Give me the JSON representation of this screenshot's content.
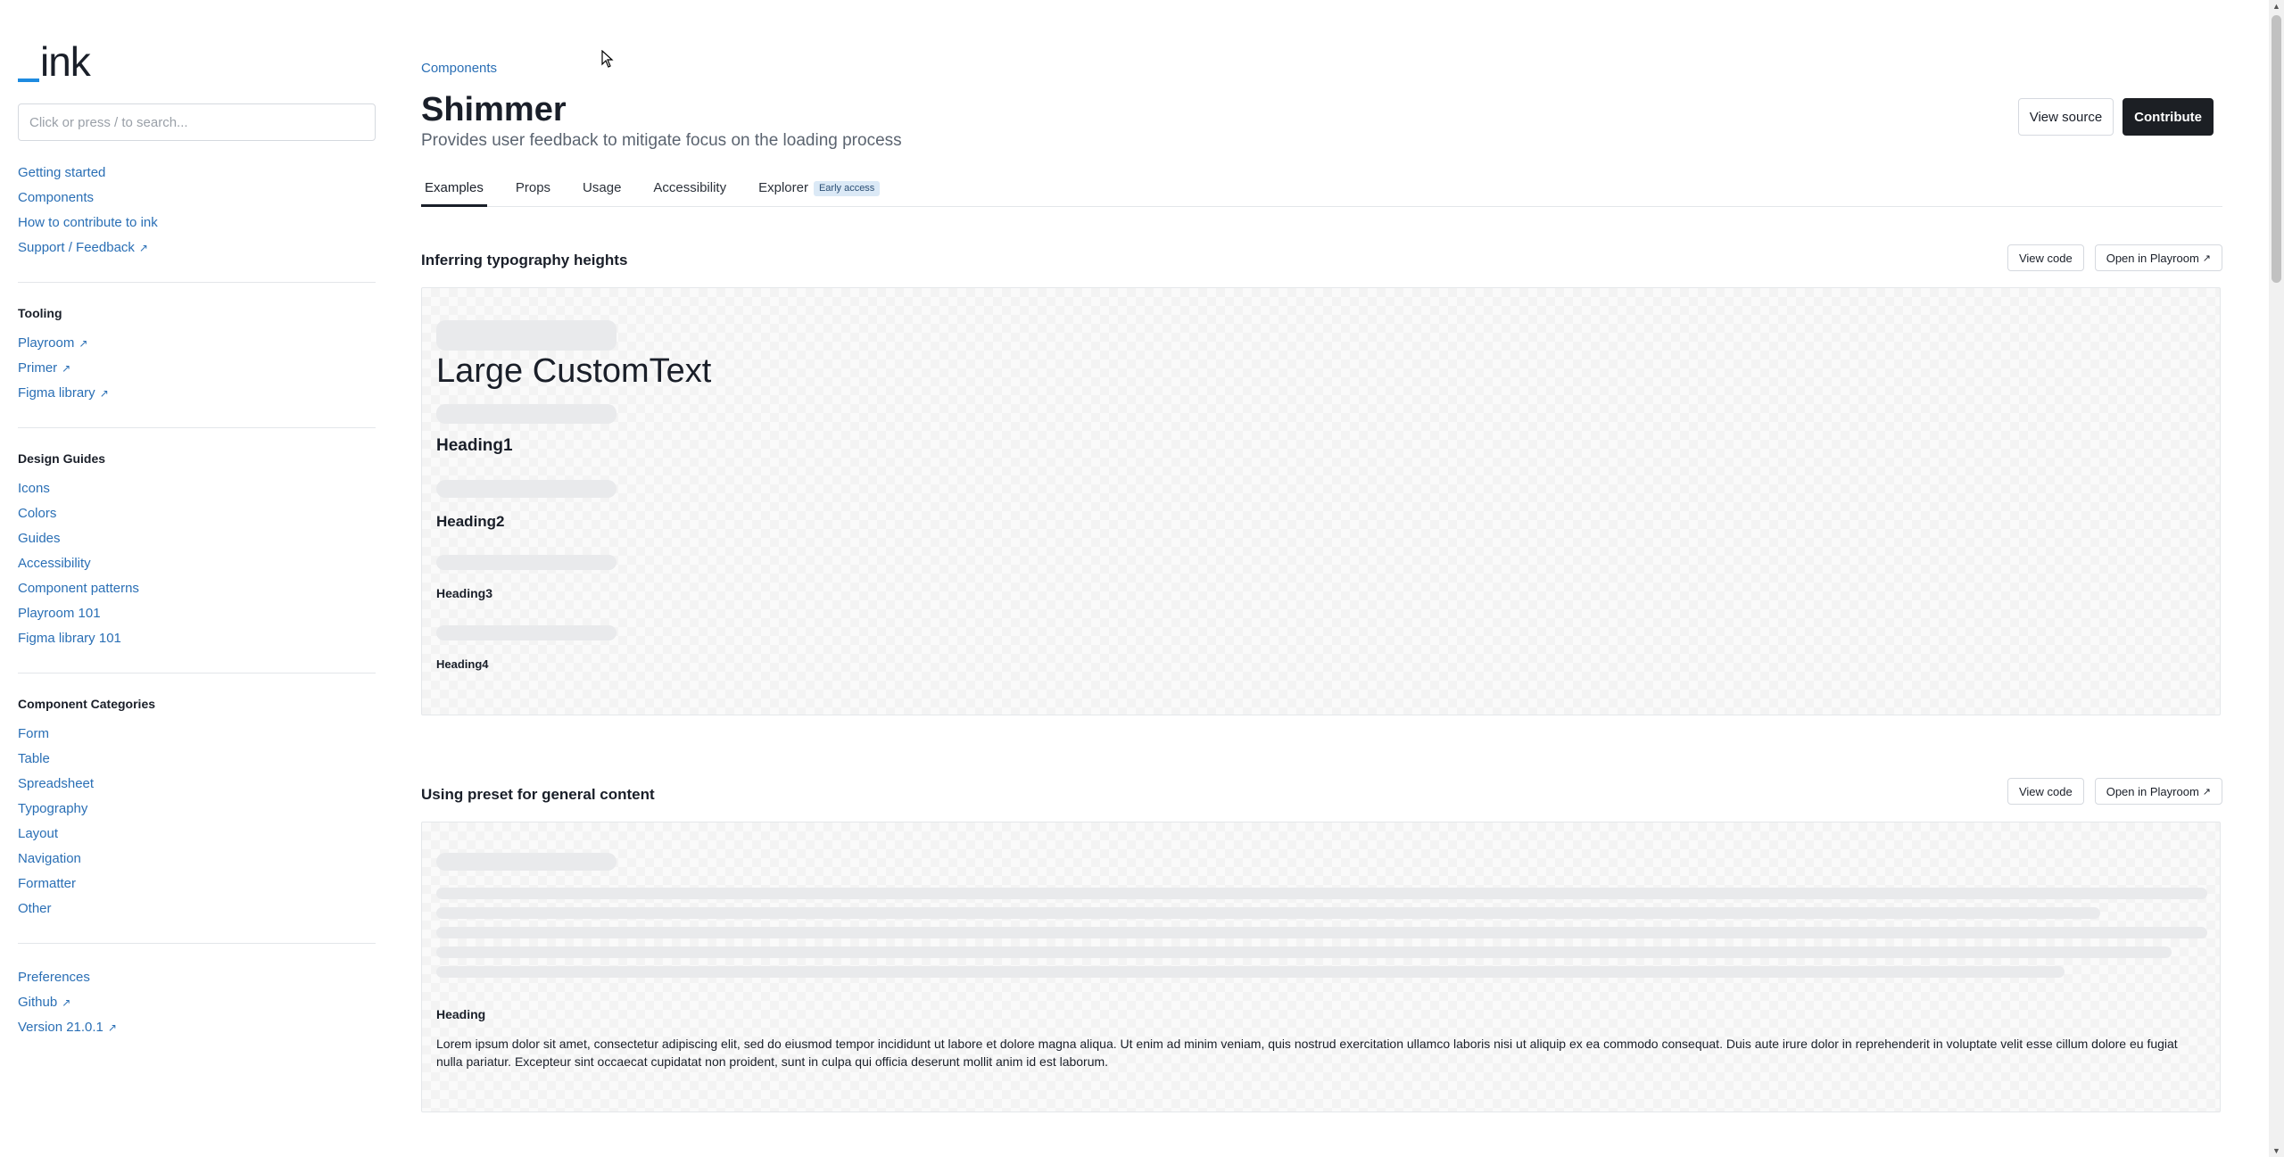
{
  "sidebar": {
    "logo": "ink",
    "search_placeholder": "Click or press / to search...",
    "primary_links": [
      {
        "label": "Getting started"
      },
      {
        "label": "Components"
      },
      {
        "label": "How to contribute to ink"
      },
      {
        "label": "Support / Feedback",
        "external": "↗"
      }
    ],
    "tooling": {
      "title": "Tooling",
      "links": [
        {
          "label": "Playroom",
          "external": "↗"
        },
        {
          "label": "Primer",
          "external": "↗"
        },
        {
          "label": "Figma library",
          "external": "↗"
        }
      ]
    },
    "design_guides": {
      "title": "Design Guides",
      "links": [
        "Icons",
        "Colors",
        "Guides",
        "Accessibility",
        "Component patterns",
        "Playroom 101",
        "Figma library 101"
      ]
    },
    "component_categories": {
      "title": "Component Categories",
      "links": [
        "Form",
        "Table",
        "Spreadsheet",
        "Typography",
        "Layout",
        "Navigation",
        "Formatter",
        "Other"
      ]
    },
    "footer_links": [
      {
        "label": "Preferences"
      },
      {
        "label": "Github",
        "external": "↗"
      },
      {
        "label": "Version 21.0.1",
        "external": "↗"
      }
    ]
  },
  "header": {
    "breadcrumb": "Components",
    "title": "Shimmer",
    "subtitle": "Provides user feedback to mitigate focus on the loading process",
    "view_source": "View source",
    "contribute": "Contribute"
  },
  "tabs": [
    {
      "label": "Examples",
      "active": true
    },
    {
      "label": "Props"
    },
    {
      "label": "Usage"
    },
    {
      "label": "Accessibility"
    },
    {
      "label": "Explorer",
      "badge": "Early access"
    }
  ],
  "sections": [
    {
      "title": "Inferring typography heights",
      "view_code": "View code",
      "open_playroom": "Open in Playroom",
      "external": "↗",
      "items": {
        "large_custom_text": "Large CustomText",
        "heading1": "Heading1",
        "heading2": "Heading2",
        "heading3": "Heading3",
        "heading4": "Heading4"
      }
    },
    {
      "title": "Using preset for general content",
      "view_code": "View code",
      "open_playroom": "Open in Playroom",
      "external": "↗",
      "heading": "Heading",
      "paragraph": "Lorem ipsum dolor sit amet, consectetur adipiscing elit, sed do eiusmod tempor incididunt ut labore et dolore magna aliqua. Ut enim ad minim veniam, quis nostrud exercitation ullamco laboris nisi ut aliquip ex ea commodo consequat. Duis aute irure dolor in reprehenderit in voluptate velit esse cillum dolore eu fugiat nulla pariatur. Excepteur sint occaecat cupidatat non proident, sunt in culpa qui officia deserunt mollit anim id est laborum."
    }
  ],
  "colors": {
    "link": "#2a6fb5",
    "accent_bar": "#1e8be0",
    "primary_button": "#1c1f24",
    "shimmer": "#e9eaec",
    "badge_bg": "#dbe9f6"
  }
}
